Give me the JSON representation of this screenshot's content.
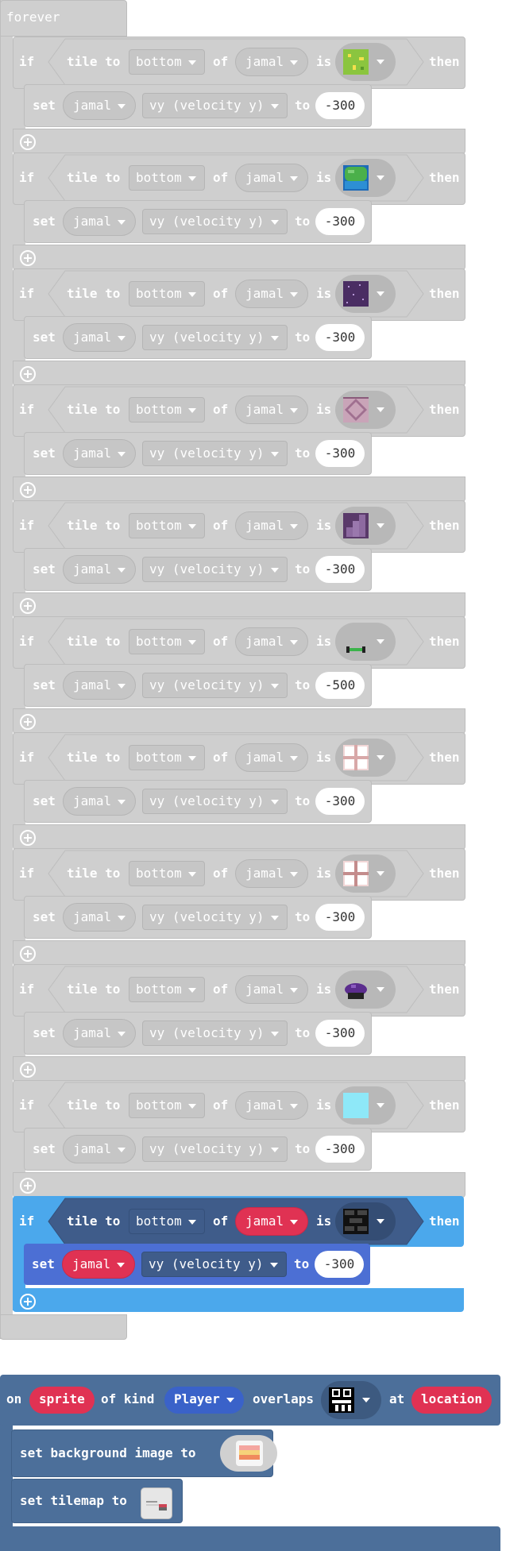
{
  "forever": {
    "label": "forever"
  },
  "if_blocks": [
    {
      "if": "if",
      "tile_to": "tile to",
      "direction": "bottom",
      "of": "of",
      "sprite": "jamal",
      "is": "is",
      "then": "then",
      "tile": "grass-tile",
      "set": "set",
      "set_sprite": "jamal",
      "property": "vy (velocity y)",
      "to": "to",
      "value": "-300",
      "style": "gray"
    },
    {
      "if": "if",
      "tile_to": "tile to",
      "direction": "bottom",
      "of": "of",
      "sprite": "jamal",
      "is": "is",
      "then": "then",
      "tile": "tree-tile",
      "set": "set",
      "set_sprite": "jamal",
      "property": "vy (velocity y)",
      "to": "to",
      "value": "-300",
      "style": "gray"
    },
    {
      "if": "if",
      "tile_to": "tile to",
      "direction": "bottom",
      "of": "of",
      "sprite": "jamal",
      "is": "is",
      "then": "then",
      "tile": "purple-dots-tile",
      "set": "set",
      "set_sprite": "jamal",
      "property": "vy (velocity y)",
      "to": "to",
      "value": "-300",
      "style": "gray"
    },
    {
      "if": "if",
      "tile_to": "tile to",
      "direction": "bottom",
      "of": "of",
      "sprite": "jamal",
      "is": "is",
      "then": "then",
      "tile": "diamond-tile",
      "set": "set",
      "set_sprite": "jamal",
      "property": "vy (velocity y)",
      "to": "to",
      "value": "-300",
      "style": "gray"
    },
    {
      "if": "if",
      "tile_to": "tile to",
      "direction": "bottom",
      "of": "of",
      "sprite": "jamal",
      "is": "is",
      "then": "then",
      "tile": "stairs-tile",
      "set": "set",
      "set_sprite": "jamal",
      "property": "vy (velocity y)",
      "to": "to",
      "value": "-300",
      "style": "gray"
    },
    {
      "if": "if",
      "tile_to": "tile to",
      "direction": "bottom",
      "of": "of",
      "sprite": "jamal",
      "is": "is",
      "then": "then",
      "tile": "springboard-tile",
      "set": "set",
      "set_sprite": "jamal",
      "property": "vy (velocity y)",
      "to": "to",
      "value": "-500",
      "style": "gray"
    },
    {
      "if": "if",
      "tile_to": "tile to",
      "direction": "bottom",
      "of": "of",
      "sprite": "jamal",
      "is": "is",
      "then": "then",
      "tile": "pink-block-tile",
      "set": "set",
      "set_sprite": "jamal",
      "property": "vy (velocity y)",
      "to": "to",
      "value": "-300",
      "style": "gray"
    },
    {
      "if": "if",
      "tile_to": "tile to",
      "direction": "bottom",
      "of": "of",
      "sprite": "jamal",
      "is": "is",
      "then": "then",
      "tile": "pink-block-tile-2",
      "set": "set",
      "set_sprite": "jamal",
      "property": "vy (velocity y)",
      "to": "to",
      "value": "-300",
      "style": "gray"
    },
    {
      "if": "if",
      "tile_to": "tile to",
      "direction": "bottom",
      "of": "of",
      "sprite": "jamal",
      "is": "is",
      "then": "then",
      "tile": "purple-bush-tile",
      "set": "set",
      "set_sprite": "jamal",
      "property": "vy (velocity y)",
      "to": "to",
      "value": "-300",
      "style": "gray"
    },
    {
      "if": "if",
      "tile_to": "tile to",
      "direction": "bottom",
      "of": "of",
      "sprite": "jamal",
      "is": "is",
      "then": "then",
      "tile": "light-blue-tile",
      "set": "set",
      "set_sprite": "jamal",
      "property": "vy (velocity y)",
      "to": "to",
      "value": "-300",
      "style": "gray"
    },
    {
      "if": "if",
      "tile_to": "tile to",
      "direction": "bottom",
      "of": "of",
      "sprite": "jamal",
      "is": "is",
      "then": "then",
      "tile": "brick-tile",
      "set": "set",
      "set_sprite": "jamal",
      "property": "vy (velocity y)",
      "to": "to",
      "value": "-300",
      "style": "blue"
    }
  ],
  "event": {
    "on": "on",
    "sprite": "sprite",
    "of_kind": "of kind",
    "kind": "Player",
    "overlaps": "overlaps",
    "tile": "castle-tile",
    "at": "at",
    "location": "location",
    "set_background": "set background image to",
    "background_image": "sunset-image",
    "set_tilemap": "set tilemap to",
    "tilemap": "tilemap-thumbnail"
  },
  "colors": {
    "disabled_block": "#cfcfcf",
    "logic_blue": "#4ba8ec",
    "sprite_red": "#e03253",
    "event_blue": "#4c6f9a",
    "set_blue": "#4c6fd4"
  }
}
